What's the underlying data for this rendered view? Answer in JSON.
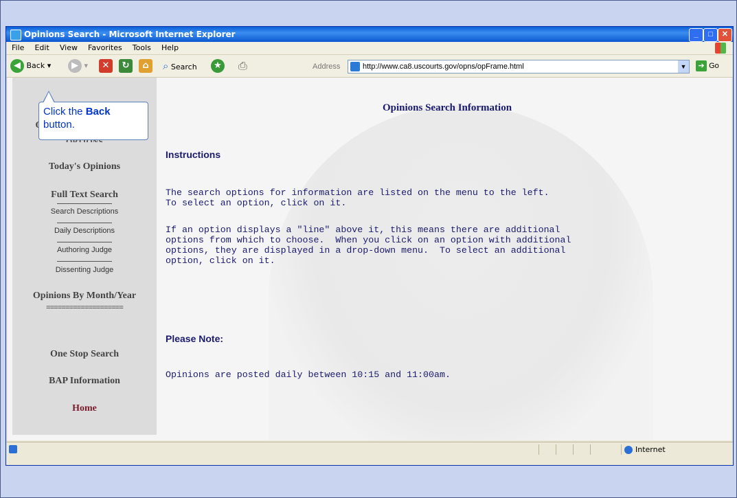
{
  "window": {
    "title": "Opinions Search - Microsoft Internet Explorer"
  },
  "menubar": [
    "File",
    "Edit",
    "View",
    "Favorites",
    "Tools",
    "Help"
  ],
  "toolbar": {
    "back_label": "Back",
    "search_label": "Search",
    "address_label": "Address",
    "address_value": "http://www.ca8.uscourts.gov/opns/opFrame.html",
    "go_label": "Go"
  },
  "callout": {
    "prefix": "Click the ",
    "bold": "Back",
    "suffix": "button."
  },
  "left_menu": {
    "partial_top_letter": "O",
    "partial_top_word": "OPTIONS",
    "items": [
      "Today's Opinions",
      "Full Text Search",
      "Opinions By Month/Year",
      "One Stop Search",
      "BAP Information",
      "Home"
    ],
    "subitems": [
      "Search Descriptions",
      "Daily Descriptions",
      "Authoring Judge",
      "Dissenting Judge"
    ],
    "divider": "===================="
  },
  "main": {
    "title": "Opinions Search Information",
    "instructions_heading": "Instructions",
    "para1": "The search options for information are listed on the menu to the left.\nTo select an option, click on it.",
    "para2": "If an option displays a \"line\" above it, this means there are additional\noptions from which to choose.  When you click on an option with additional\noptions, they are displayed in a drop-down menu.  To select an additional\noption, click on it.",
    "note_heading": "Please Note:",
    "note_text": "Opinions are posted daily between 10:15 and 11:00am."
  },
  "statusbar": {
    "zone": "Internet"
  },
  "colors": {
    "title_blue": "#1a1a6e",
    "callout_text": "#0033cc",
    "home_link": "#7a1a2a"
  }
}
